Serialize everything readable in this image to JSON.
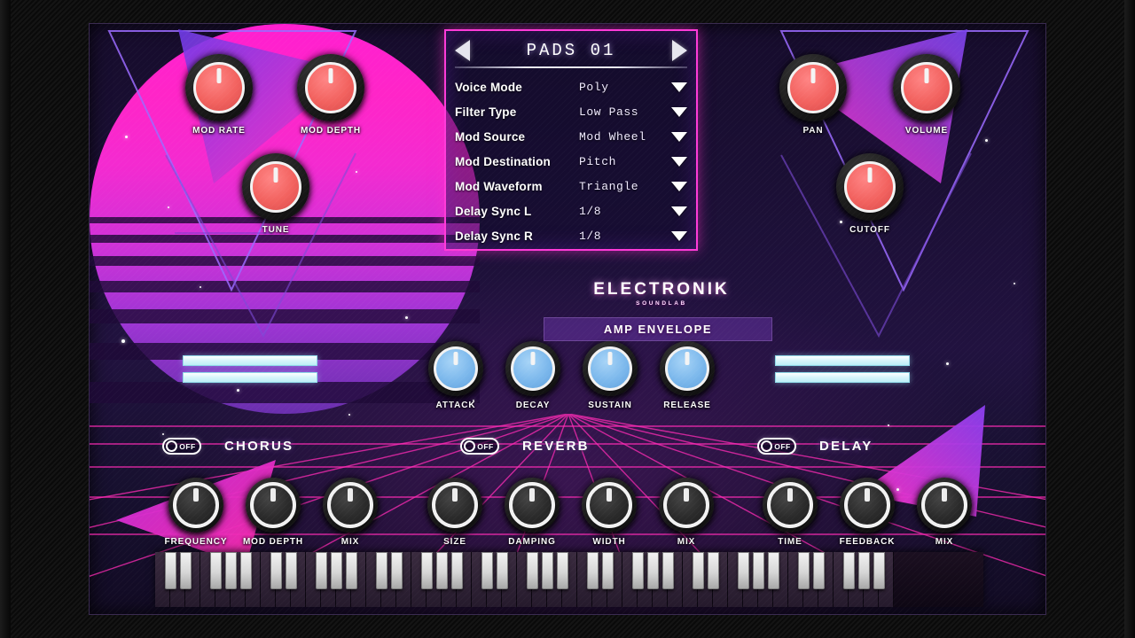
{
  "app": {
    "brand": "ELECTRONIK",
    "brand_sub": "SOUNDLAB",
    "amp_envelope_label": "AMP ENVELOPE",
    "accent_pink": "#ff3ad8",
    "accent_purple": "#8a3ff0",
    "knob_red": "#f2625f",
    "knob_blue": "#7cb8ec",
    "meter_cyan": "#bdeef7"
  },
  "browser": {
    "preset_name": "PADS 01",
    "prev_arrow": "arrow-left-icon",
    "next_arrow": "arrow-right-icon",
    "params": [
      {
        "label": "Voice Mode",
        "value": "Poly"
      },
      {
        "label": "Filter Type",
        "value": "Low Pass"
      },
      {
        "label": "Mod Source",
        "value": "Mod Wheel"
      },
      {
        "label": "Mod Destination",
        "value": "Pitch"
      },
      {
        "label": "Mod Waveform",
        "value": "Triangle"
      },
      {
        "label": "Delay Sync L",
        "value": "1/8"
      },
      {
        "label": "Delay Sync R",
        "value": "1/8"
      }
    ]
  },
  "knobs_left": [
    {
      "label": "MOD RATE",
      "color": "red"
    },
    {
      "label": "MOD DEPTH",
      "color": "red"
    },
    {
      "label": "TUNE",
      "color": "red"
    }
  ],
  "knobs_right": [
    {
      "label": "PAN",
      "color": "red"
    },
    {
      "label": "VOLUME",
      "color": "red"
    },
    {
      "label": "CUTOFF",
      "color": "red"
    }
  ],
  "amp_envelope": {
    "knobs": [
      {
        "label": "ATTACK",
        "color": "blue"
      },
      {
        "label": "DECAY",
        "color": "blue"
      },
      {
        "label": "SUSTAIN",
        "color": "blue"
      },
      {
        "label": "RELEASE",
        "color": "blue"
      }
    ]
  },
  "effects": [
    {
      "name": "CHORUS",
      "toggle_state": "OFF",
      "knobs": [
        {
          "label": "FREQUENCY"
        },
        {
          "label": "MOD DEPTH"
        },
        {
          "label": "MIX"
        }
      ]
    },
    {
      "name": "REVERB",
      "toggle_state": "OFF",
      "knobs": [
        {
          "label": "SIZE"
        },
        {
          "label": "DAMPING"
        },
        {
          "label": "WIDTH"
        },
        {
          "label": "MIX"
        }
      ]
    },
    {
      "name": "DELAY",
      "toggle_state": "OFF",
      "knobs": [
        {
          "label": "TIME"
        },
        {
          "label": "FEEDBACK"
        },
        {
          "label": "MIX"
        }
      ]
    }
  ],
  "meters": {
    "left": {
      "bars": 2
    },
    "right": {
      "bars": 2
    }
  },
  "keyboard": {
    "octaves": 7,
    "keys_per_octave": 7
  }
}
